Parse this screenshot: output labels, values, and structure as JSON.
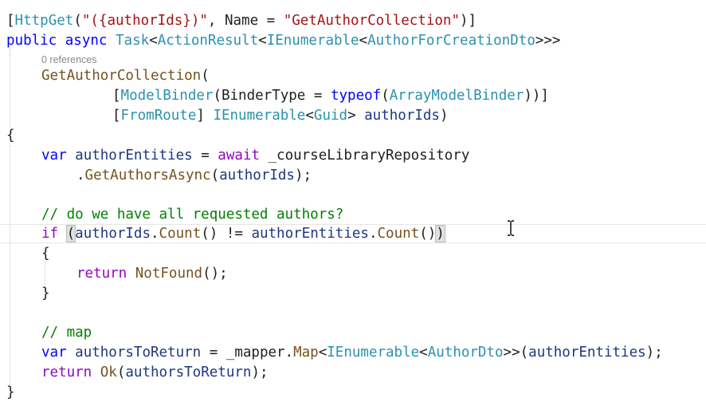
{
  "code": {
    "line1": {
      "open": "[",
      "attr": "HttpGet",
      "paren_open": "(",
      "route": "\"({authorIds})\"",
      "sep": ", Name = ",
      "name": "\"GetAuthorCollection\"",
      "close": ")]"
    },
    "line2": {
      "kw_public": "public",
      "kw_async": "async",
      "t_task": "Task",
      "lt1": "<",
      "t_actionresult": "ActionResult",
      "lt2": "<",
      "t_ienumerable": "IEnumerable",
      "lt3": "<",
      "t_dto": "AuthorForCreationDto",
      "gt": ">>>"
    },
    "codelens": "0 references",
    "line3": {
      "method": "GetAuthorCollection",
      "paren": "("
    },
    "line4": {
      "open": "[",
      "attr": "ModelBinder",
      "p1": "(BinderType = ",
      "kw_typeof": "typeof",
      "p2": "(",
      "t_binder": "ArrayModelBinder",
      "close": "))]"
    },
    "line5": {
      "open": "[",
      "attr": "FromRoute",
      "close": "] ",
      "t_ienumerable": "IEnumerable",
      "lt": "<",
      "t_guid": "Guid",
      "gt": "> ",
      "param": "authorIds",
      "end": ")"
    },
    "brace_open": "{",
    "line7": {
      "kw_var": "var",
      "local": "authorEntities",
      "eq": " = ",
      "kw_await": "await",
      "field": " _courseLibraryRepository"
    },
    "line8": {
      "dot": ".",
      "method": "GetAuthorsAsync",
      "p_open": "(",
      "arg": "authorIds",
      "p_close": ");"
    },
    "comment1": "// do we have all requested authors?",
    "line11": {
      "kw_if": "if",
      "paren_open": "(",
      "var1": "authorIds",
      "dot1": ".",
      "count1": "Count",
      "mid": "() != ",
      "var2": "authorEntities",
      "dot2": ".",
      "count2": "Count",
      "call": "()",
      "paren_close": ")"
    },
    "inner_open": "{",
    "line13": {
      "kw_return": "return",
      "method": "NotFound",
      "rest": "();"
    },
    "inner_close": "}",
    "comment2": "// map",
    "line17": {
      "kw_var": "var",
      "local": "authorsToReturn",
      "eq": " = _mapper.",
      "method": "Map",
      "lt1": "<",
      "t_ienumerable": "IEnumerable",
      "lt2": "<",
      "t_dto": "AuthorDto",
      "gt": ">>(",
      "arg": "authorEntities",
      "end": ");"
    },
    "line18": {
      "kw_return": "return",
      "method": "Ok",
      "p_open": "(",
      "arg": "authorsToReturn",
      "end": ");"
    },
    "brace_close": "}"
  },
  "colors": {
    "type": "#2b91af",
    "string": "#a31515",
    "keyword": "#0000ff",
    "control": "#8f08c4",
    "method": "#74531f",
    "variable": "#1f377f",
    "comment": "#008000",
    "background": "#ffffff"
  }
}
